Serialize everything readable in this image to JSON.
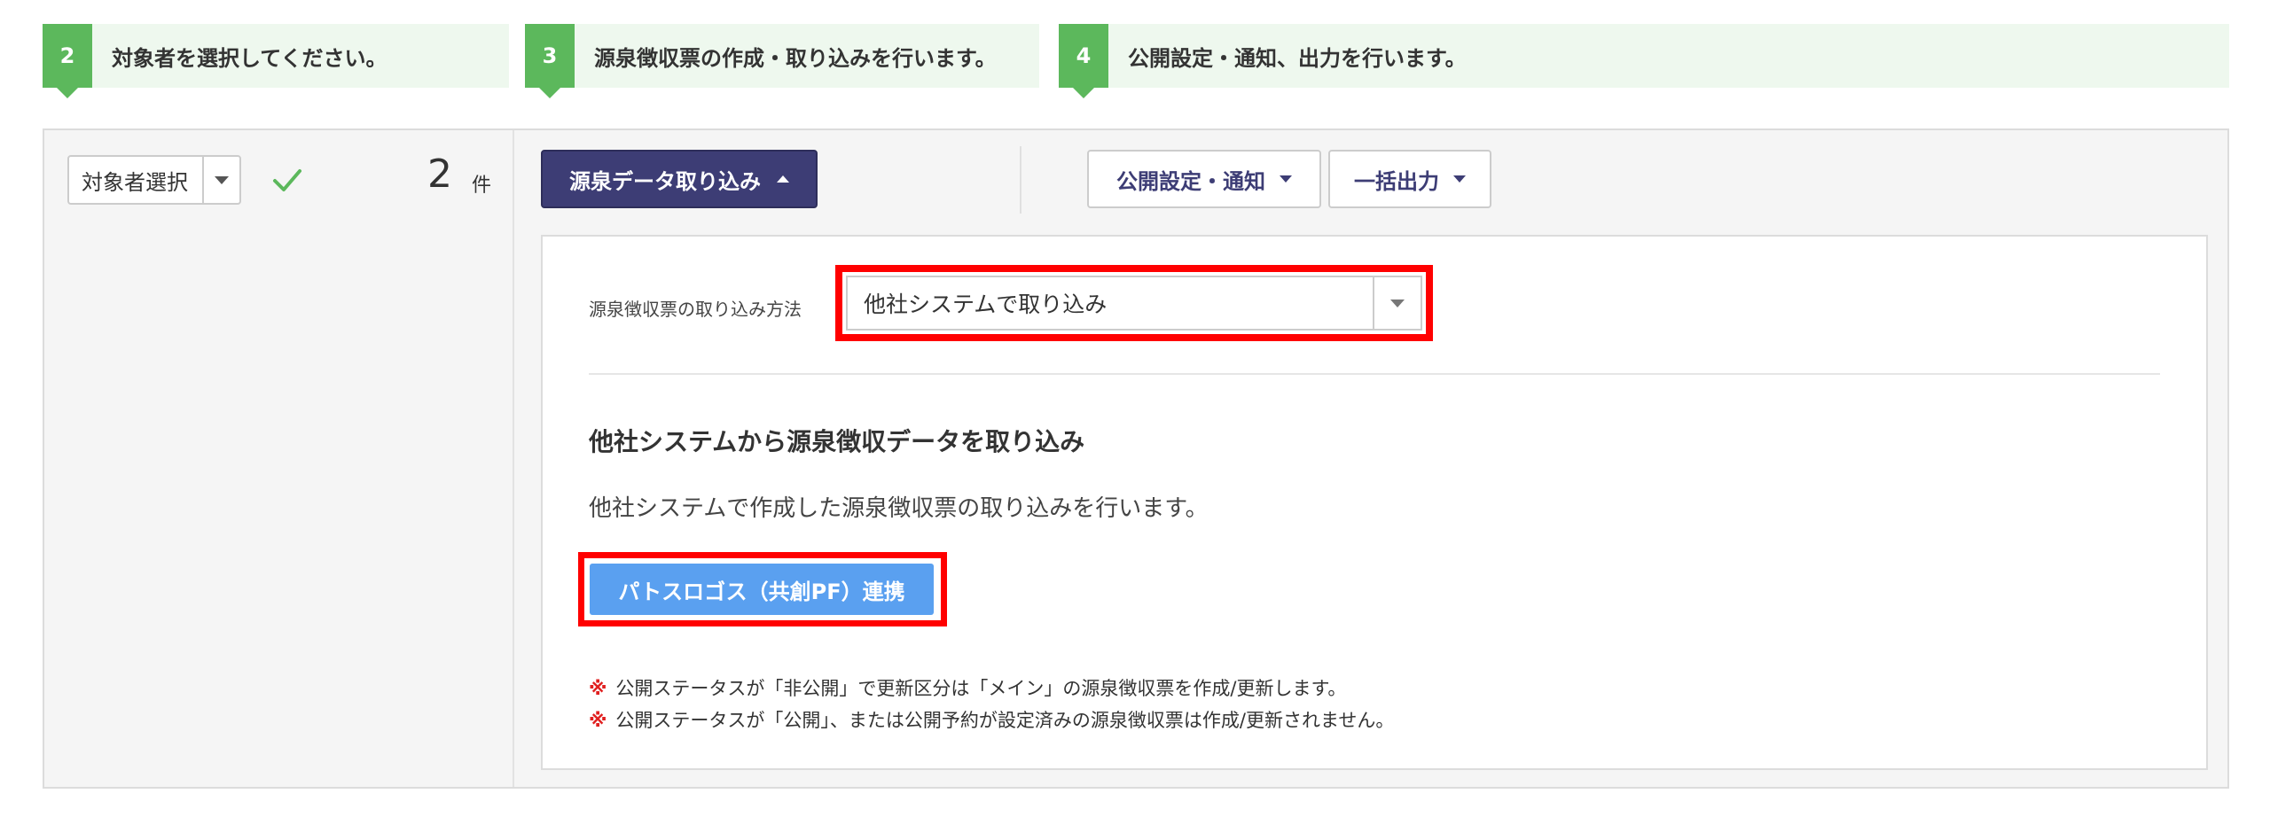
{
  "steps": [
    {
      "number": "2",
      "label": "対象者を選択してください。"
    },
    {
      "number": "3",
      "label": "源泉徴収票の作成・取り込みを行います。"
    },
    {
      "number": "4",
      "label": "公開設定・通知、出力を行います。"
    }
  ],
  "left": {
    "target_select_label": "対象者選択",
    "count_value": "2",
    "count_unit": "件"
  },
  "toolbar": {
    "import_button": "源泉データ取り込み",
    "publish_button": "公開設定・通知",
    "export_button": "一括出力"
  },
  "import_panel": {
    "method_label": "源泉徴収票の取り込み方法",
    "method_value": "他社システムで取り込み",
    "heading": "他社システムから源泉徴収データを取り込み",
    "description": "他社システムで作成した源泉徴収票の取り込みを行います。",
    "link_button": "パトスロゴス（共創PF）連携",
    "notes": [
      {
        "mark": "※",
        "text": "公開ステータスが「非公開」で更新区分は「メイン」の源泉徴収票を作成/更新します。"
      },
      {
        "mark": "※",
        "text": "公開ステータスが「公開」、または公開予約が設定済みの源泉徴収票は作成/更新されません。"
      }
    ]
  },
  "colors": {
    "step_green": "#5cb85c",
    "step_bg": "#eef8ee",
    "primary_navy": "#3d3d75",
    "link_blue": "#5aa0f0",
    "highlight_red": "#ff0000",
    "note_mark_red": "#e02020"
  },
  "icons": {
    "check": "check-icon",
    "dropdown": "chevron-down-icon",
    "collapse": "chevron-up-icon"
  }
}
